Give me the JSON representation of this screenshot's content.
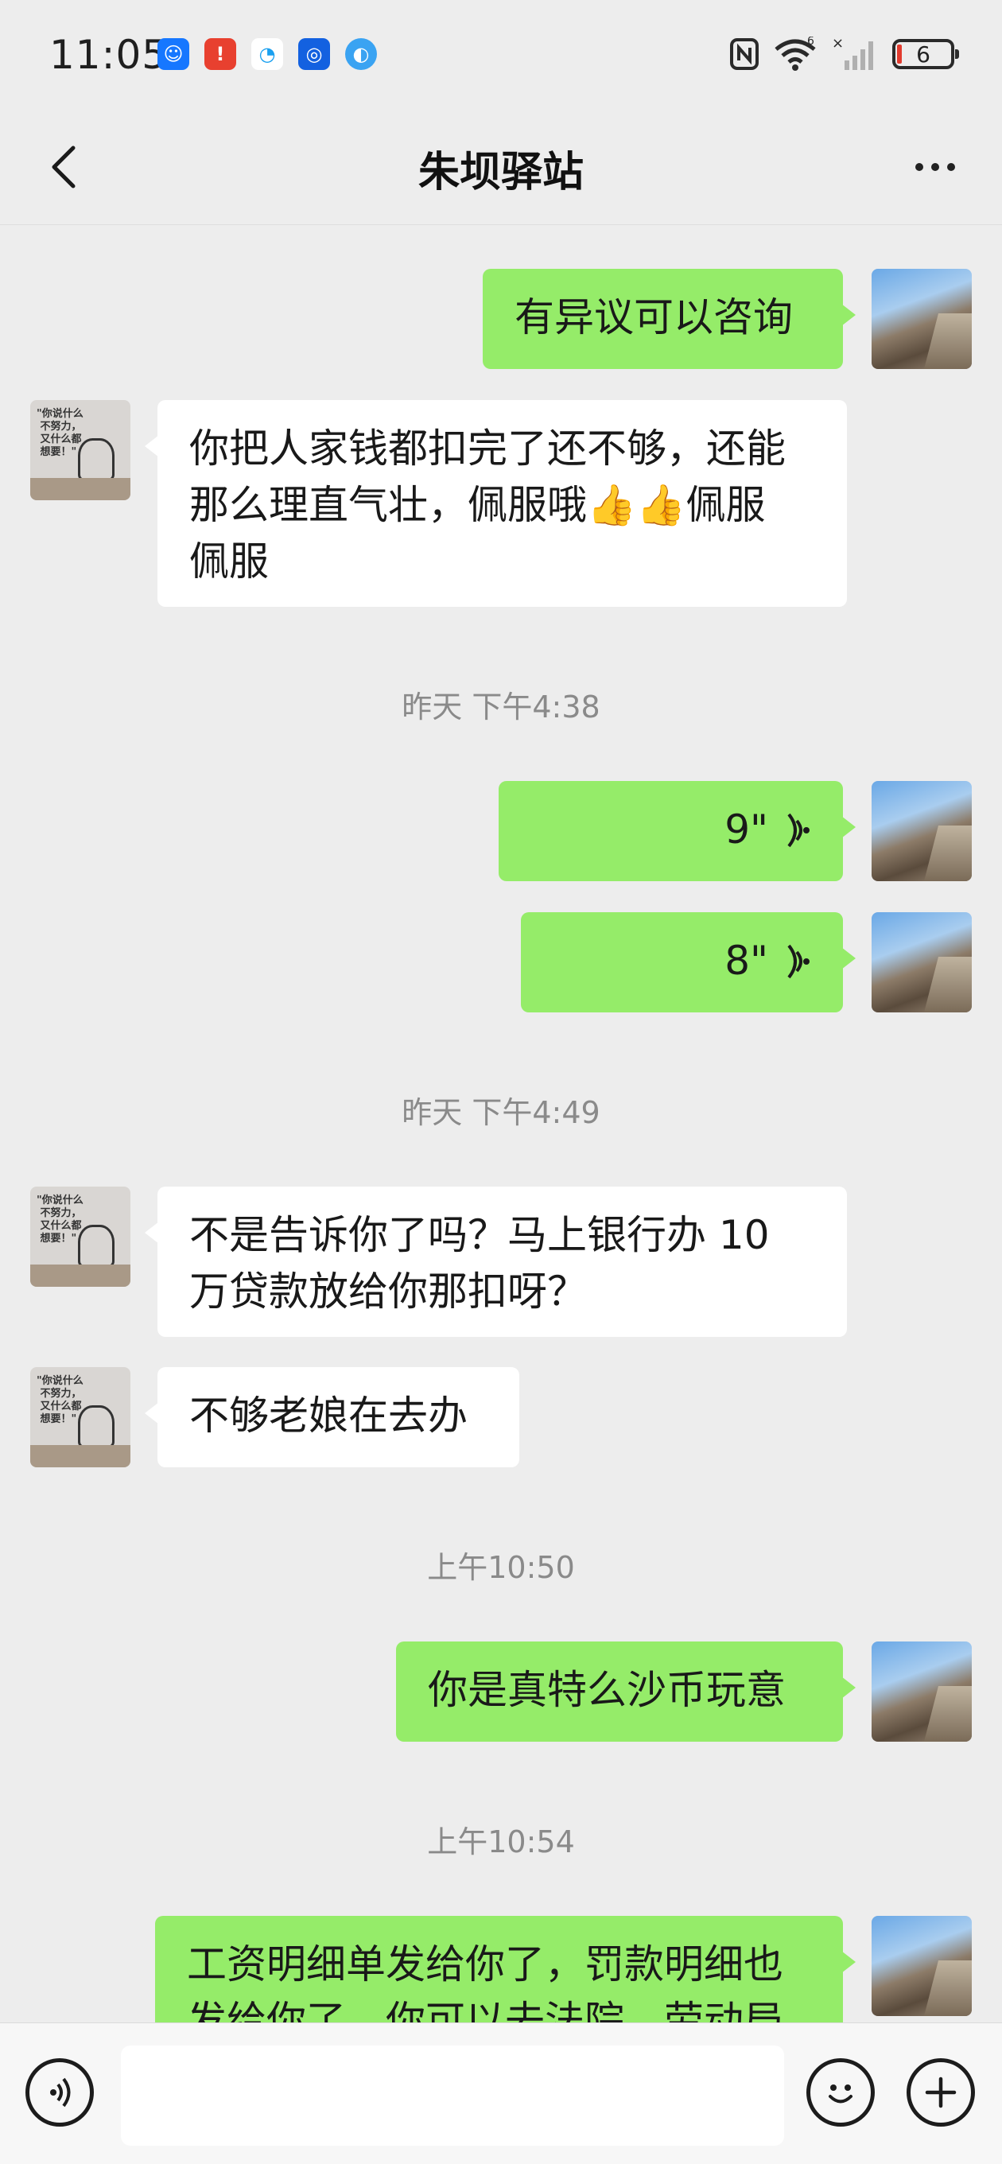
{
  "status_bar": {
    "time": "11:05",
    "battery_level": "6",
    "network_label": "6",
    "icons": [
      "face-app-icon",
      "battery-alert-icon",
      "chat-app-icon",
      "bulb-app-icon",
      "browser-app-icon",
      "nfc-icon",
      "wifi-icon",
      "signal-icon",
      "battery-icon"
    ]
  },
  "header": {
    "title": "朱坝驿站",
    "back_icon": "chevron-left-icon",
    "more_icon": "more-dots-icon"
  },
  "messages": [
    {
      "side": "me",
      "type": "text",
      "text": "有异议可以咨询"
    },
    {
      "side": "them",
      "type": "text",
      "lines": [
        "你把人家钱都扣完了还不够，还能",
        "那么理直气壮，佩服哦👍👍佩服",
        "佩服"
      ]
    },
    {
      "type": "time",
      "text": "昨天 下午4:38"
    },
    {
      "side": "me",
      "type": "voice",
      "duration": "9\""
    },
    {
      "side": "me",
      "type": "voice",
      "duration": "8\""
    },
    {
      "type": "time",
      "text": "昨天 下午4:49"
    },
    {
      "side": "them",
      "type": "text",
      "lines": [
        "不是告诉你了吗？马上银行办 10",
        "万贷款放给你那扣呀？"
      ]
    },
    {
      "side": "them",
      "type": "text",
      "text": "不够老娘在去办"
    },
    {
      "type": "time",
      "text": "上午10:50"
    },
    {
      "side": "me",
      "type": "text",
      "text": "你是真特么沙币玩意"
    },
    {
      "type": "time",
      "text": "上午10:54"
    },
    {
      "side": "me",
      "type": "text",
      "lines": [
        "工资明细单发给你了，罚款明细也",
        "发给你了，你可以去法院，劳动局"
      ]
    }
  ],
  "input_bar": {
    "voice_icon": "voice-input-icon",
    "text_value": "",
    "emoji_icon": "emoji-icon",
    "plus_icon": "plus-icon"
  }
}
